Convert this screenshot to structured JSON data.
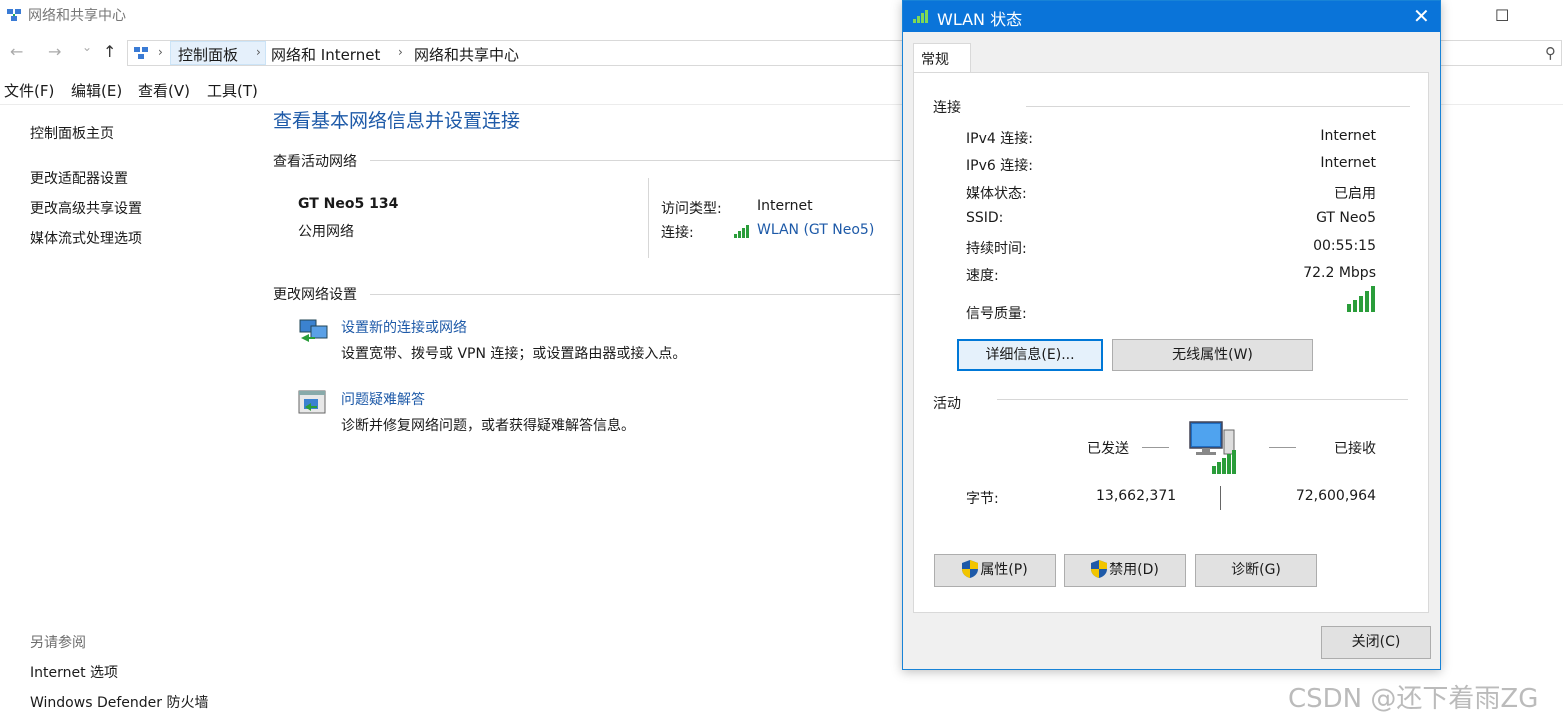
{
  "window": {
    "title": "网络和共享中心",
    "nav": {
      "back": "←",
      "forward": "→",
      "dropdown": "⌄",
      "up": "↑"
    },
    "breadcrumb": [
      "控制面板",
      "网络和 Internet",
      "网络和共享中心"
    ],
    "controls": {
      "minimize": "—",
      "maximize": "☐"
    }
  },
  "menu": [
    "文件(F)",
    "编辑(E)",
    "查看(V)",
    "工具(T)"
  ],
  "sidebar": {
    "items": [
      "控制面板主页",
      "更改适配器设置",
      "更改高级共享设置",
      "媒体流式处理选项"
    ],
    "see_also_label": "另请参阅",
    "see_also": [
      "Internet 选项",
      "Windows Defender 防火墙"
    ]
  },
  "main": {
    "title": "查看基本网络信息并设置连接",
    "active_label": "查看活动网络",
    "network_name": "GT Neo5 134",
    "network_type": "公用网络",
    "access_type_label": "访问类型:",
    "access_type_value": "Internet",
    "connection_label": "连接:",
    "connection_value": "WLAN (GT Neo5)",
    "change_label": "更改网络设置",
    "tasks": [
      {
        "title": "设置新的连接或网络",
        "desc": "设置宽带、拨号或 VPN 连接；或设置路由器或接入点。"
      },
      {
        "title": "问题疑难解答",
        "desc": "诊断并修复网络问题，或者获得疑难解答信息。"
      }
    ]
  },
  "dialog": {
    "title": "WLAN 状态",
    "close": "✕",
    "tab": "常规",
    "connection_group": "连接",
    "rows": [
      {
        "label": "IPv4 连接:",
        "value": "Internet"
      },
      {
        "label": "IPv6 连接:",
        "value": "Internet"
      },
      {
        "label": "媒体状态:",
        "value": "已启用"
      },
      {
        "label": "SSID:",
        "value": "GT Neo5"
      },
      {
        "label": "持续时间:",
        "value": "00:55:15"
      },
      {
        "label": "速度:",
        "value": "72.2 Mbps"
      }
    ],
    "signal_label": "信号质量:",
    "details_button": "详细信息(E)...",
    "wireless_button": "无线属性(W)",
    "activity_group": "活动",
    "sent_label": "已发送",
    "received_label": "已接收",
    "bytes_label": "字节:",
    "bytes_sent": "13,662,371",
    "bytes_received": "72,600,964",
    "properties_button": "属性(P)",
    "disable_button": "禁用(D)",
    "diagnose_button": "诊断(G)",
    "close_button": "关闭(C)"
  },
  "watermark": "CSDN @还下着雨ZG"
}
